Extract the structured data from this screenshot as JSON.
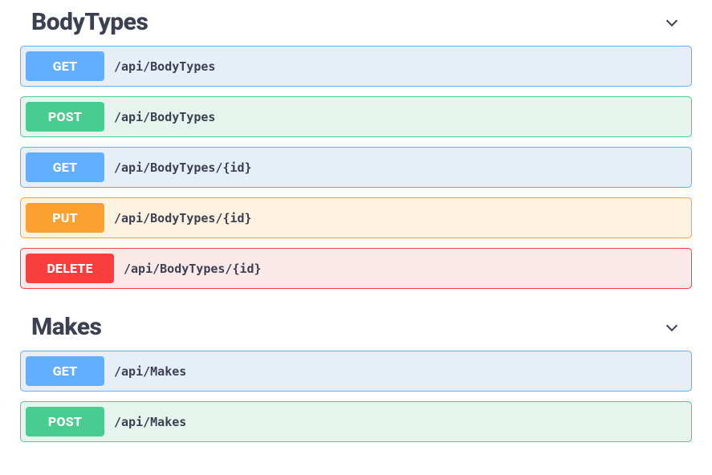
{
  "sections": [
    {
      "title": "BodyTypes",
      "ops": [
        {
          "method": "GET",
          "path": "/api/BodyTypes"
        },
        {
          "method": "POST",
          "path": "/api/BodyTypes"
        },
        {
          "method": "GET",
          "path": "/api/BodyTypes/{id}"
        },
        {
          "method": "PUT",
          "path": "/api/BodyTypes/{id}"
        },
        {
          "method": "DELETE",
          "path": "/api/BodyTypes/{id}"
        }
      ]
    },
    {
      "title": "Makes",
      "ops": [
        {
          "method": "GET",
          "path": "/api/Makes"
        },
        {
          "method": "POST",
          "path": "/api/Makes"
        }
      ]
    }
  ]
}
